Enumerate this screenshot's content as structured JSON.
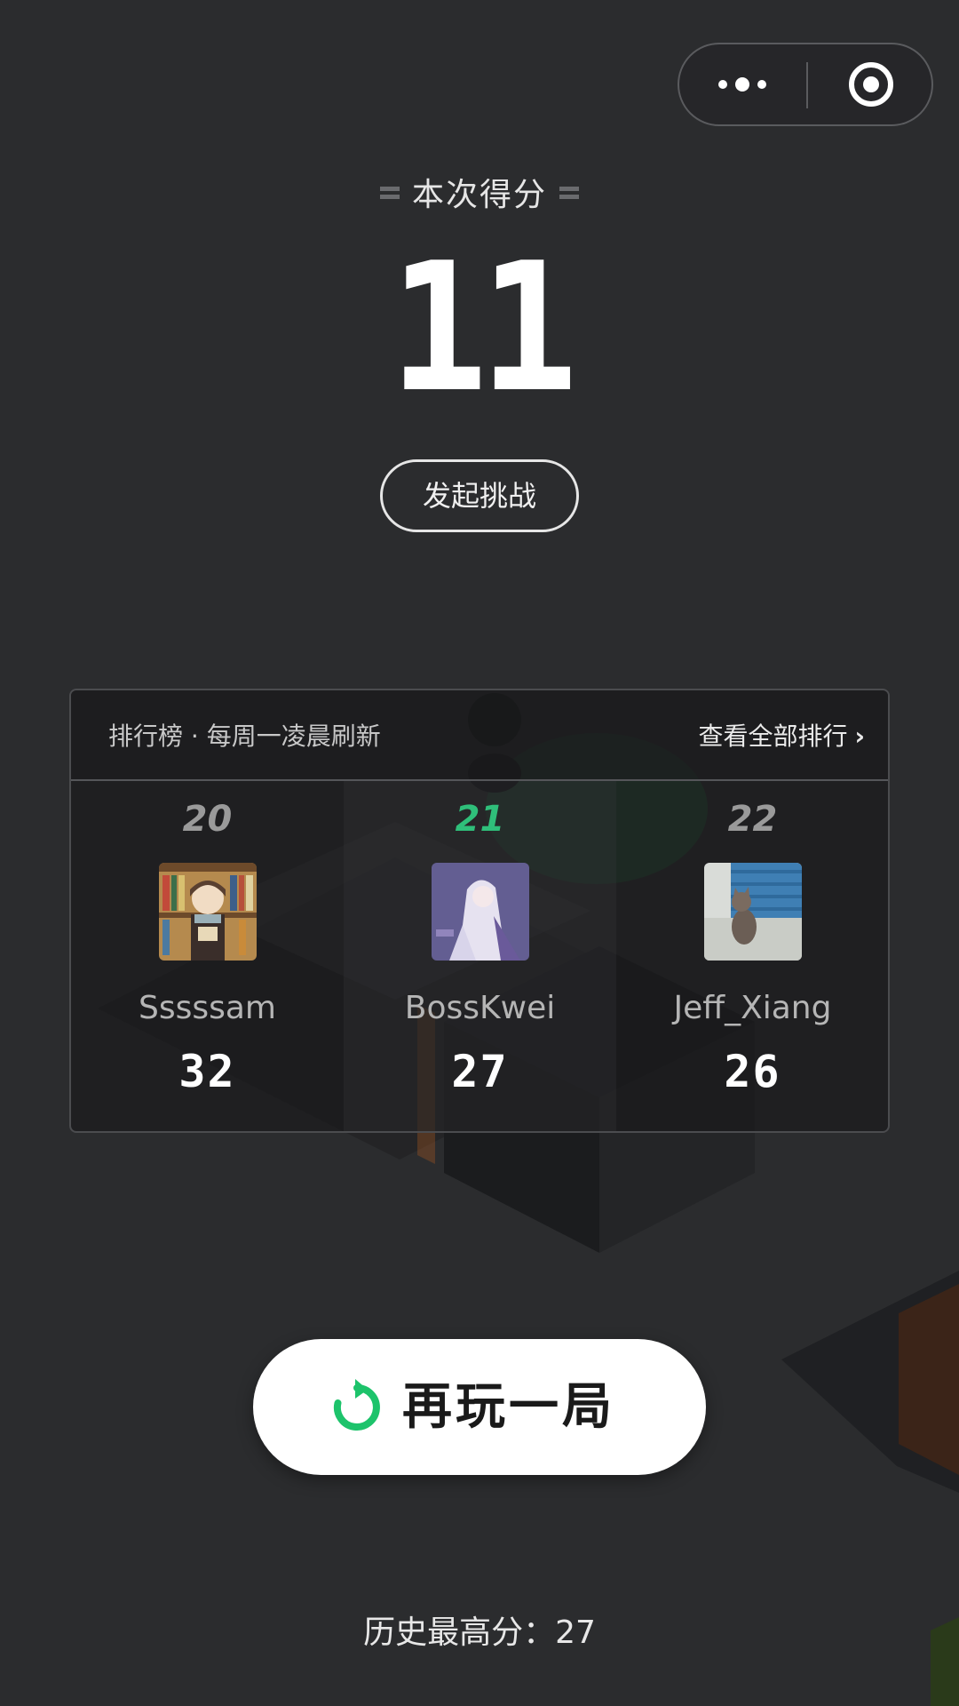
{
  "score": {
    "title": "本次得分",
    "value": "11",
    "challenge_label": "发起挑战"
  },
  "leaderboard": {
    "header": "排行榜 · 每周一凌晨刷新",
    "view_all": "查看全部排行",
    "entries": [
      {
        "rank": "20",
        "name": "Sssssam",
        "score": "32",
        "is_self": false
      },
      {
        "rank": "21",
        "name": "BossKwei",
        "score": "27",
        "is_self": true
      },
      {
        "rank": "22",
        "name": "Jeff_Xiang",
        "score": "26",
        "is_self": false
      }
    ]
  },
  "replay": {
    "label": "再玩一局"
  },
  "best_score": "历史最高分：27",
  "colors": {
    "background": "#2b2c2e",
    "self_rank": "#2fbf7a",
    "replay_icon": "#1dc36b"
  }
}
